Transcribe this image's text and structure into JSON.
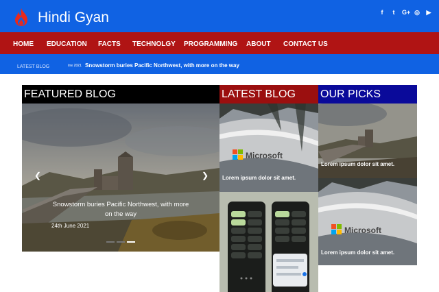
{
  "site": {
    "name": "Hindi Gyan"
  },
  "social_icons": [
    "facebook-icon",
    "twitter-icon",
    "google-plus-icon",
    "instagram-icon",
    "youtube-icon"
  ],
  "social_glyphs": [
    "f",
    "t",
    "G+",
    "◎",
    "▶"
  ],
  "nav": [
    "HOME",
    "EDUCATION",
    "FACTS",
    "TECHNOLGY",
    "PROGRAMMING",
    "ABOUT",
    "CONTACT US"
  ],
  "ticker": {
    "label": "LATEST BLOG",
    "date": "ine 2021",
    "headline": "Snowstorm buries Pacific Northwest, with more on the way"
  },
  "featured": {
    "title": "FEATURED BLOG",
    "caption": "Snowstorm buries Pacific Northwest, with more on the way",
    "date": "24th June 2021",
    "slides": 3,
    "active_slide": 3
  },
  "latest": {
    "title": "LATEST BLOG",
    "items": [
      {
        "caption": "Lorem ipsum dolor sit amet."
      }
    ]
  },
  "picks": {
    "title": "OUR PICKS",
    "items": [
      {
        "caption": "Lorem ipsum dolor sit amet."
      },
      {
        "caption": "Lorem ipsum dolor sit amet."
      }
    ]
  },
  "colors": {
    "brand_blue": "#1062e3",
    "nav_red": "#b01414",
    "featured_header": "#000000",
    "latest_header": "#9b0f0f",
    "picks_header": "#0a0a9a"
  }
}
